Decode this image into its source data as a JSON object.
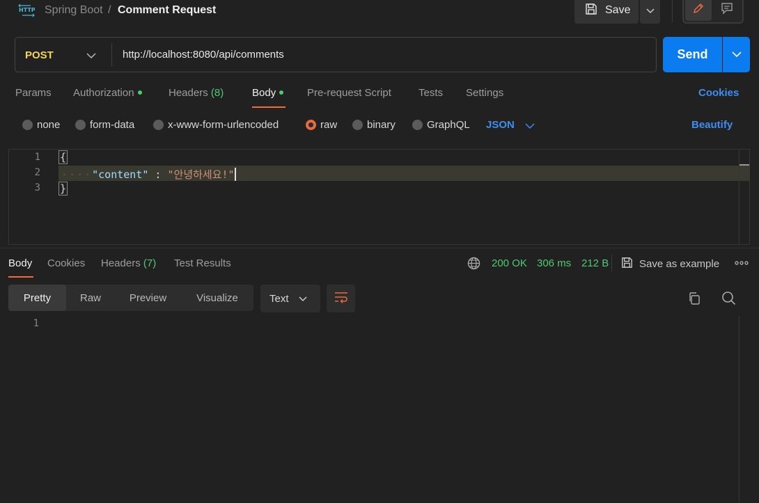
{
  "header": {
    "icon_text": "HTTP",
    "breadcrumb_parent": "Spring Boot",
    "breadcrumb_separator": "/",
    "title": "Comment Request",
    "save_label": "Save"
  },
  "request": {
    "method": "POST",
    "url": "http://localhost:8080/api/comments",
    "send_label": "Send",
    "method_color": "#f5d45c",
    "send_color": "#0b7cf0"
  },
  "request_tabs": {
    "params": "Params",
    "authorization": "Authorization",
    "headers": "Headers",
    "headers_count": "(8)",
    "body": "Body",
    "pre_request": "Pre-request Script",
    "tests": "Tests",
    "settings": "Settings",
    "cookies_link": "Cookies",
    "active": "Body"
  },
  "body_types": {
    "none": "none",
    "form_data": "form-data",
    "urlencoded": "x-www-form-urlencoded",
    "raw": "raw",
    "binary": "binary",
    "graphql": "GraphQL",
    "selected": "raw",
    "language": "JSON",
    "beautify_link": "Beautify"
  },
  "editor": {
    "line_numbers": [
      "1",
      "2",
      "3"
    ],
    "line1": "{",
    "line2_key": "\"content\"",
    "line2_colon": " : ",
    "line2_value": "\"안녕하세요!\"",
    "line3": "}"
  },
  "response_tabs": {
    "body": "Body",
    "cookies": "Cookies",
    "headers": "Headers",
    "headers_count": "(7)",
    "test_results": "Test Results",
    "active": "Body"
  },
  "response_meta": {
    "status": "200 OK",
    "time": "306 ms",
    "size": "212 B",
    "save_as_example": "Save as example",
    "status_color": "#4ecb71"
  },
  "response_view": {
    "pretty": "Pretty",
    "raw": "Raw",
    "preview": "Preview",
    "visualize": "Visualize",
    "active": "Pretty",
    "format": "Text",
    "line_numbers": [
      "1"
    ]
  },
  "colors": {
    "accent_underline": "#f26b3a",
    "link_blue": "#3d8ef0",
    "background": "#212121"
  }
}
